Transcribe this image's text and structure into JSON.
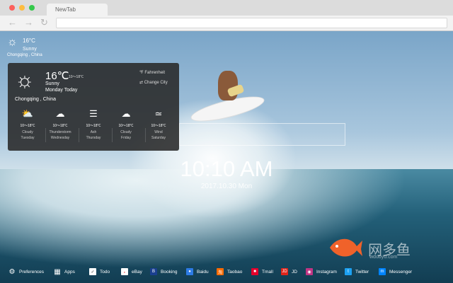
{
  "browser": {
    "tab_title": "NewTab",
    "back_icon": "back-arrow-icon",
    "forward_icon": "forward-arrow-icon",
    "reload_icon": "reload-icon"
  },
  "weather_mini": {
    "temp": "16°C",
    "condition": "Sunny",
    "location": "Chongqing , China",
    "icon": "sun-icon"
  },
  "weather_panel": {
    "temp": "16℃",
    "range": "10～18℃",
    "condition": "Sunny",
    "day": "Monday Today",
    "unit_link": "℉ Fahrenheit",
    "change_city_link": "⇄ Change City",
    "city": "Chongqing , China",
    "forecast": [
      {
        "icon": "cloudy-icon",
        "range": "10～18℃",
        "condition": "Cloudy",
        "day": "Tuesday"
      },
      {
        "icon": "thunderstorm-icon",
        "range": "10～18℃",
        "condition": "Thunderstorm",
        "day": "Wednesday"
      },
      {
        "icon": "ash-icon",
        "range": "10～18℃",
        "condition": "Ash",
        "day": "Thursday"
      },
      {
        "icon": "cloud-icon",
        "range": "10～18℃",
        "condition": "Cloudy",
        "day": "Friday"
      },
      {
        "icon": "wind-icon",
        "range": "10～18℃",
        "condition": "Wind",
        "day": "Saturday"
      }
    ]
  },
  "clock": {
    "time": "10:10 AM",
    "date": "2017.10.30 Mon"
  },
  "watermark": {
    "text": "网多鱼",
    "url": "wduoyu.com"
  },
  "bottom_bar": {
    "preferences": "Preferences",
    "apps": "Apps",
    "links": [
      {
        "label": "Todo",
        "icon": "checkbox-icon",
        "color": "#ffffff"
      },
      {
        "label": "eBay",
        "icon": "ebay-icon",
        "color": "#ffffff"
      },
      {
        "label": "Booking",
        "icon": "booking-icon",
        "color": "#1a3f8f"
      },
      {
        "label": "Baidu",
        "icon": "baidu-icon",
        "color": "#2d7be5"
      },
      {
        "label": "Taobao",
        "icon": "taobao-icon",
        "color": "#ff6a00"
      },
      {
        "label": "Tmall",
        "icon": "tmall-icon",
        "color": "#e4002b"
      },
      {
        "label": "JD",
        "icon": "jd-icon",
        "color": "#e1251b"
      },
      {
        "label": "Instagram",
        "icon": "instagram-icon",
        "color": "#c13584"
      },
      {
        "label": "Twitter",
        "icon": "twitter-icon",
        "color": "#1da1f2"
      },
      {
        "label": "Messenger",
        "icon": "messenger-icon",
        "color": "#0084ff"
      }
    ]
  }
}
